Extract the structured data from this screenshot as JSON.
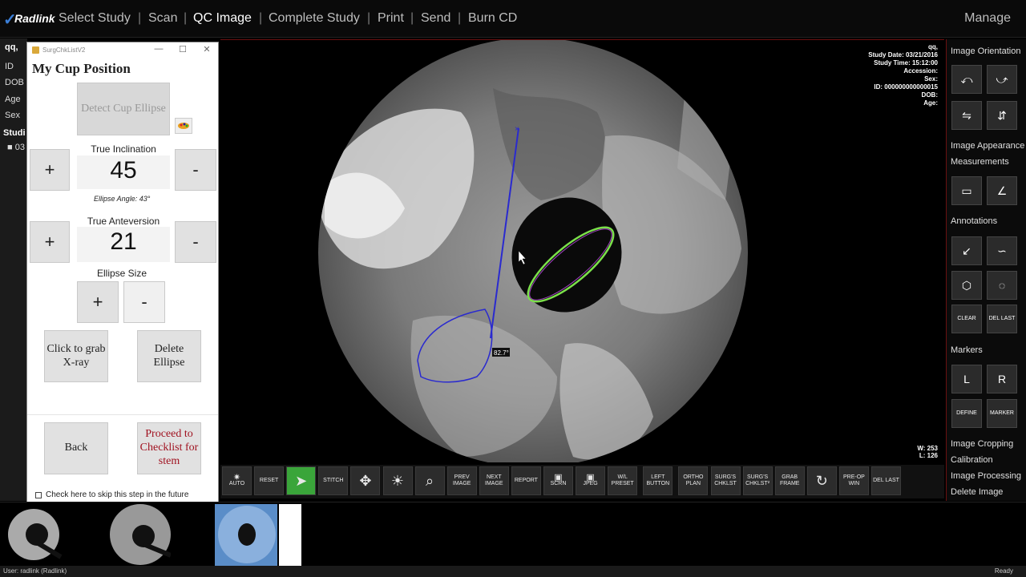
{
  "app": {
    "logo_text": "Radlink"
  },
  "nav": {
    "items": [
      "Select Study",
      "Scan",
      "QC Image",
      "Complete Study",
      "Print",
      "Send",
      "Burn CD"
    ],
    "active": "QC Image",
    "manage": "Manage"
  },
  "patient": {
    "name": "qq,",
    "labels": [
      "ID",
      "DOB",
      "Age",
      "Sex"
    ],
    "studies_label": "Studi",
    "study_item": "03"
  },
  "dialog": {
    "window_title": "SurgChkListV2",
    "heading": "My Cup Position",
    "detect_button": "Detect Cup Ellipse",
    "inclination": {
      "label": "True Inclination",
      "value": "45",
      "plus": "+",
      "minus": "-",
      "note": "Ellipse Angle: 43°"
    },
    "anteversion": {
      "label": "True Anteversion",
      "value": "21",
      "plus": "+",
      "minus": "-"
    },
    "ellipse_size": {
      "label": "Ellipse Size",
      "plus": "+",
      "minus": "-"
    },
    "grab_button": "Click to grab X-ray",
    "delete_button": "Delete Ellipse",
    "back_button": "Back",
    "proceed_button": "Proceed to Checklist for stem",
    "skip_label": "Check here to skip this step in the future"
  },
  "image_info": {
    "name": "qq,",
    "lines": [
      "Study Date: 03/21/2016",
      "Study Time: 15:12:00",
      "Accession:",
      "Sex:",
      "ID: 000000000000015",
      "DOB:",
      "Age:"
    ],
    "angle_label": "82.7°",
    "wl": [
      "W: 253",
      "L: 126"
    ]
  },
  "toolbar": [
    {
      "name": "auto-button",
      "label": "AUTO"
    },
    {
      "name": "reset-button",
      "label": "RESET"
    },
    {
      "name": "select-button",
      "label": ""
    },
    {
      "name": "stitch-button",
      "label": "STITCH"
    },
    {
      "name": "pan-button",
      "label": ""
    },
    {
      "name": "brightness-button",
      "label": ""
    },
    {
      "name": "zoom-button",
      "label": ""
    },
    {
      "name": "prev-image-button",
      "label": "PREV IMAGE"
    },
    {
      "name": "next-image-button",
      "label": "NEXT IMAGE"
    },
    {
      "name": "report-button",
      "label": "REPORT"
    },
    {
      "name": "scrn-button",
      "label": "SCRN"
    },
    {
      "name": "jpeg-button",
      "label": "JPEG"
    },
    {
      "name": "wl-preset-button",
      "label": "W/L PRESET"
    },
    {
      "name": "left-button",
      "label": "LEFT BUTTON"
    },
    {
      "name": "ortho-plan-button",
      "label": "ORTHO PLAN"
    },
    {
      "name": "surgs-chklst-button",
      "label": "SURG'S CHKLST"
    },
    {
      "name": "surgs-chklst2-button",
      "label": "SURG'S CHKLST²"
    },
    {
      "name": "grab-frame-button",
      "label": "GRAB FRAME"
    },
    {
      "name": "rotate-button",
      "label": ""
    },
    {
      "name": "pre-op-win-button",
      "label": "PRE-OP WIN"
    },
    {
      "name": "del-last-button",
      "label": "DEL LAST"
    }
  ],
  "right_panel": {
    "image_orientation": "Image Orientation",
    "image_appearance": "Image Appearance",
    "measurements": "Measurements",
    "annotations": "Annotations",
    "clear": "CLEAR",
    "del_last": "DEL LAST",
    "markers": "Markers",
    "marker_l": "L",
    "marker_r": "R",
    "define": "DEFINE",
    "marker": "MARKER",
    "image_cropping": "Image Cropping",
    "calibration": "Calibration",
    "image_processing": "Image Processing",
    "delete_image": "Delete Image"
  },
  "status": {
    "user": "User: radlink (Radlink)",
    "state": "Ready"
  },
  "colors": {
    "accent_red": "#a0111f",
    "green_button": "#3aa53a",
    "ellipse_green": "#7be04a",
    "line_blue": "#2a2acf"
  }
}
